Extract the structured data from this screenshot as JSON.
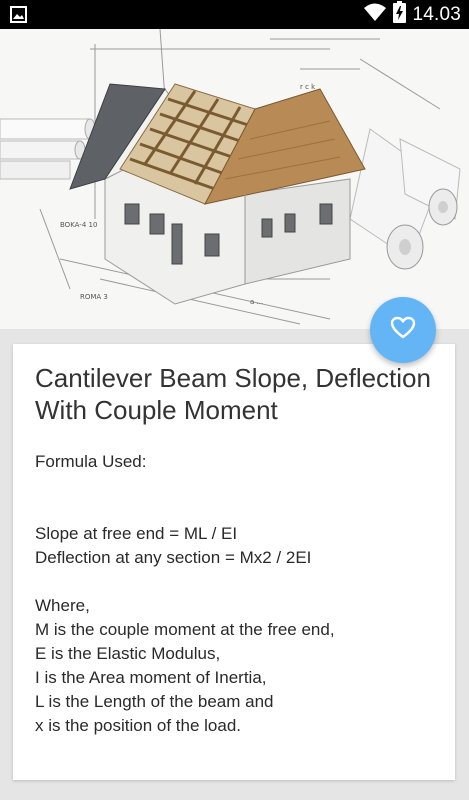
{
  "status_bar": {
    "time": "14.03",
    "icons": [
      "image-notification-icon",
      "wifi-icon",
      "battery-charging-icon"
    ]
  },
  "hero": {
    "image": "house-under-construction-blueprint-image"
  },
  "fab": {
    "icon": "heart-outline-icon",
    "color": "#64b5f6"
  },
  "article": {
    "title": "Cantilever Beam Slope, Deflection With Couple Moment",
    "body": "Formula Used:\n\n\nSlope at free end = ML / EI\nDeflection at any section = Mx2 / 2EI\n\nWhere,\nM is the couple moment at the free end,\nE is the Elastic Modulus,\nI is the Area moment of Inertia,\nL is the Length of the beam and\nx is the position of the load."
  }
}
